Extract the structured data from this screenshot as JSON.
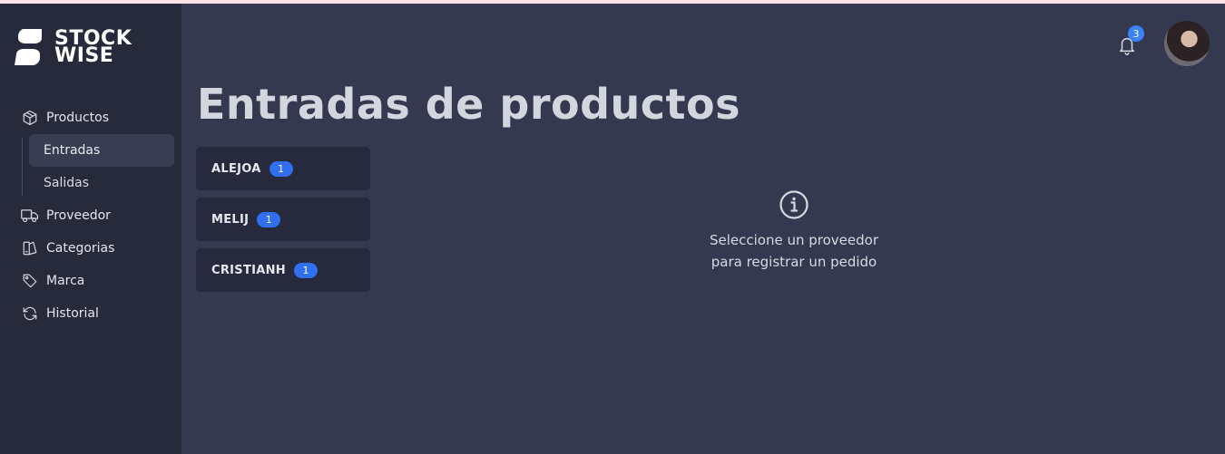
{
  "brand": {
    "line1": "STOCK",
    "line2": "WISE"
  },
  "nav": {
    "items": [
      {
        "label": "Productos",
        "icon": "box-icon"
      },
      {
        "label": "Proveedor",
        "icon": "truck-icon"
      },
      {
        "label": "Categorias",
        "icon": "category-icon"
      },
      {
        "label": "Marca",
        "icon": "tag-icon"
      },
      {
        "label": "Historial",
        "icon": "refresh-icon"
      }
    ],
    "sub_items": [
      {
        "label": "Entradas",
        "active": true
      },
      {
        "label": "Salidas",
        "active": false
      }
    ]
  },
  "topbar": {
    "notification_count": "3"
  },
  "page": {
    "title": "Entradas de productos"
  },
  "suppliers": [
    {
      "name": "ALEJOA",
      "count": "1"
    },
    {
      "name": "MELIJ",
      "count": "1"
    },
    {
      "name": "CRISTIANH",
      "count": "1"
    }
  ],
  "empty_state": {
    "line1": "Seleccione un proveedor",
    "line2": "para registrar un pedido"
  },
  "colors": {
    "sidebar_bg": "#272a3b",
    "main_bg": "#343950",
    "active_item_bg": "#393d52",
    "badge_blue": "#2f6ff0"
  }
}
